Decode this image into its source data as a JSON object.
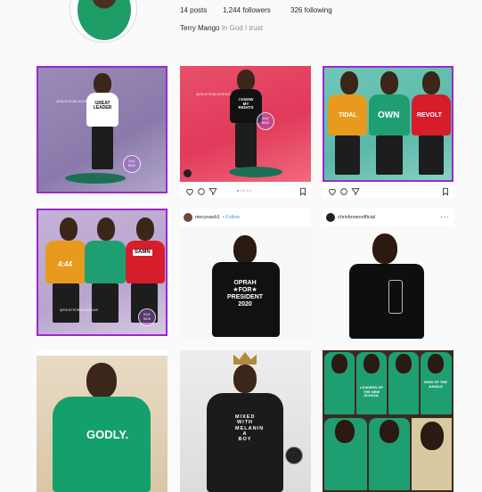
{
  "profile": {
    "posts": "14 posts",
    "followers": "1,244 followers",
    "following": "326 following",
    "name": "Terry Mango",
    "bio": "In God I trust"
  },
  "tiles": {
    "t1": {
      "shirt": "GREAT LEADER",
      "watermark": "@PAINTEDBLKDREAMS"
    },
    "t2": {
      "shirt": "I KNOW MY RIGHTS",
      "watermark": "@PAINTEDBLKDREAMS"
    },
    "t3": {
      "left": "TIDAL",
      "mid": "OWN",
      "right": "REVOLT"
    },
    "t4": {
      "left": "4:44",
      "right": "SAMN",
      "watermark": "@PAINTEDBLKDREAMS"
    },
    "t5": {
      "user": "niecynash1",
      "follow": "• Follow",
      "print": "OPRAH ★FOR★ PRESIDENT 2020"
    },
    "t6": {
      "user": "chrisbrownofficial"
    },
    "t7": {
      "print": "GODLY."
    },
    "t8": {
      "print": "MIXED WITH MELANIN A BOY"
    },
    "t9": {
      "a": "LEADERS OF THE NEW SCHOOL",
      "b": "KING OF THE JUNGLE"
    }
  },
  "colors": {
    "accent_purple": "#9c27d0",
    "link_blue": "#3897f0"
  }
}
